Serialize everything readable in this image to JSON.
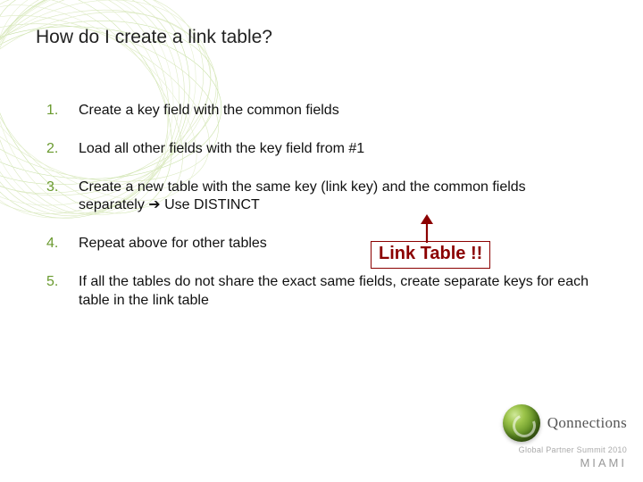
{
  "title": "How do I create a link table?",
  "steps": [
    "Create a key field with the common fields",
    "Load all other fields with the key field from #1",
    "Create a new table with the same key (link key) and the common fields separately ➔ Use DISTINCT",
    "Repeat above for other tables",
    "If all the tables do not share the exact same fields, create separate keys for each table in the link table"
  ],
  "callout": "Link Table !!",
  "footer": {
    "brand": "Qonnections",
    "sub": "Global Partner Summit 2010",
    "city": "MIAMI"
  }
}
